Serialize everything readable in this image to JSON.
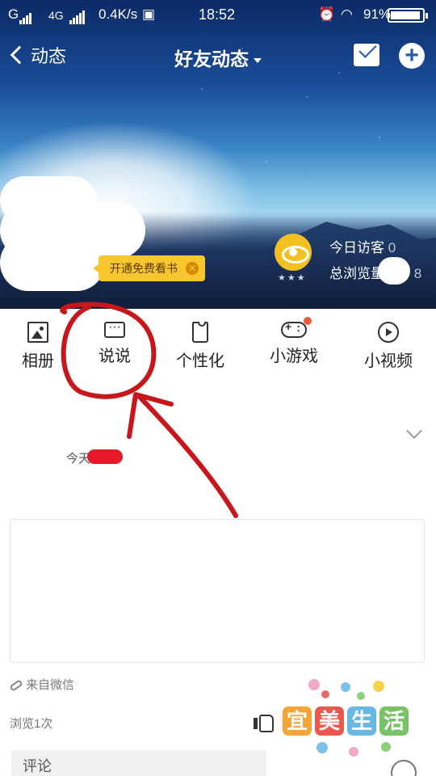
{
  "status_bar": {
    "carrier1": "G",
    "carrier2": "4G",
    "net_speed": "0.4K/s",
    "time": "18:52",
    "battery": "91%"
  },
  "nav": {
    "back_label": "动态",
    "title": "好友动态"
  },
  "hero": {
    "vip_text": "开通免费看书",
    "visitors_today_label": "今日访客",
    "visitors_today_value": "0",
    "total_views_label": "总浏览量",
    "total_views_tail": "8"
  },
  "toolbar": [
    {
      "label": "相册",
      "icon": "photo-album-icon"
    },
    {
      "label": "说说",
      "icon": "chat-bubble-icon"
    },
    {
      "label": "个性化",
      "icon": "shirt-icon"
    },
    {
      "label": "小游戏",
      "icon": "gamepad-icon"
    },
    {
      "label": "小视频",
      "icon": "video-play-icon"
    }
  ],
  "feed": {
    "date_prefix": "今天",
    "source": "来自微信",
    "views": "浏览1次",
    "comment_label": "评论"
  },
  "watermark": {
    "chars": [
      "宜",
      "美",
      "生",
      "活"
    ]
  },
  "colors": {
    "accent_yellow": "#f8c730",
    "annotation_red": "#c8161d",
    "notification_dot": "#f0583a"
  }
}
